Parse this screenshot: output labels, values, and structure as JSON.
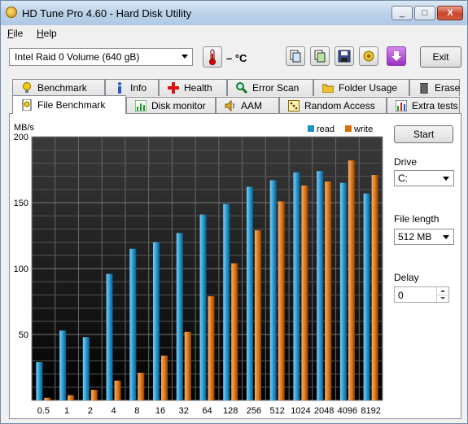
{
  "window": {
    "title": "HD Tune Pro 4.60 - Hard Disk Utility",
    "controls": [
      "_",
      "□",
      "X"
    ]
  },
  "menu": [
    {
      "label": "File",
      "accel": "F"
    },
    {
      "label": "Help",
      "accel": "H"
    }
  ],
  "toolbar": {
    "drive_select": "Intel   Raid 0 Volume (640 gB)",
    "temperature": "– °C",
    "buttons": [
      "copy-info-icon",
      "copy-screenshot-icon",
      "save-icon",
      "options-icon",
      "download-icon"
    ],
    "exit_label": "Exit"
  },
  "tabs": {
    "row1": [
      "Benchmark",
      "Info",
      "Health",
      "Error Scan",
      "Folder Usage",
      "Erase"
    ],
    "row2": [
      "File Benchmark",
      "Disk monitor",
      "AAM",
      "Random Access",
      "Extra tests"
    ],
    "active": "File Benchmark"
  },
  "controls": {
    "start_label": "Start",
    "drive_label": "Drive",
    "drive_value": "C:",
    "file_length_label": "File length",
    "file_length_value": "512 MB",
    "delay_label": "Delay",
    "delay_value": "0"
  },
  "colors": {
    "read": "#1e90c8",
    "write": "#d9700f",
    "plot_bg_top": "#3a3a3a",
    "plot_bg_bottom": "#000000"
  },
  "chart_data": {
    "type": "bar",
    "ylabel": "MB/s",
    "ylim": [
      0,
      200
    ],
    "yticks": [
      50,
      100,
      150,
      200
    ],
    "categories": [
      "0.5",
      "1",
      "2",
      "4",
      "8",
      "16",
      "32",
      "64",
      "128",
      "256",
      "512",
      "1024",
      "2048",
      "4096",
      "8192"
    ],
    "series": [
      {
        "name": "read",
        "values": [
          29,
          53,
          48,
          96,
          115,
          120,
          127,
          141,
          149,
          162,
          167,
          173,
          174,
          165,
          157
        ]
      },
      {
        "name": "write",
        "values": [
          2,
          4,
          8,
          15,
          21,
          34,
          52,
          79,
          104,
          129,
          151,
          163,
          166,
          182,
          171
        ]
      }
    ],
    "legend": "top-right",
    "grid": true
  }
}
